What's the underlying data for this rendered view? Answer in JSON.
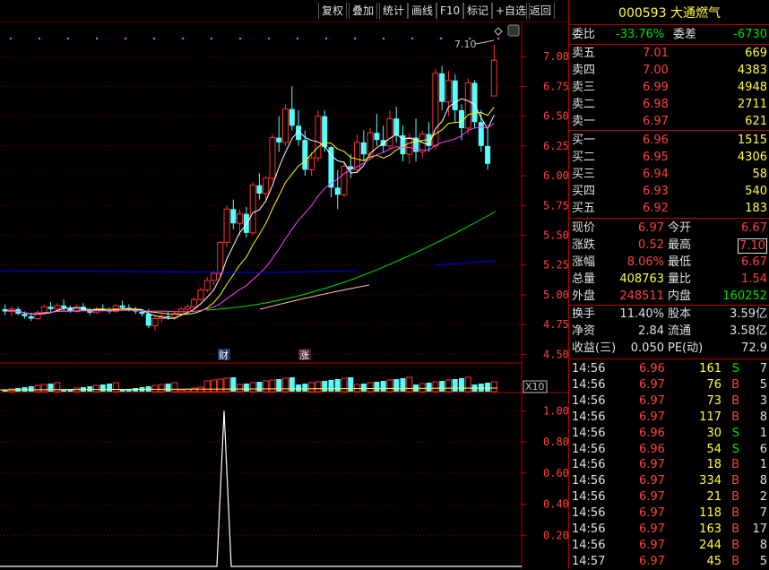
{
  "toolbar": {
    "buttons": [
      "复权",
      "叠加",
      "统计",
      "画线",
      "F10",
      "标记",
      "+自选",
      "返回"
    ]
  },
  "chart": {
    "price_ticks": [
      "7.00",
      "6.75",
      "6.50",
      "6.25",
      "6.00",
      "5.75",
      "5.50",
      "5.25",
      "5.00",
      "4.75",
      "4.50"
    ],
    "indicator_ticks": [
      "1.00",
      "0.80",
      "0.60",
      "0.40",
      "0.20"
    ],
    "high_label": "7.10",
    "event_labels": [
      "财",
      "涨"
    ],
    "volume_scale_label": "X10",
    "colors": {
      "up": "#ff3030",
      "down": "#54ffff",
      "ma5": "#ffffff",
      "ma10": "#ffff00",
      "ma20": "#ff40ff",
      "ma60": "#00e000",
      "ma120": "#ffc0c0",
      "ma250": "#0000ff"
    }
  },
  "chart_data": {
    "type": "candlestick",
    "y_range": [
      4.45,
      7.25
    ],
    "candles": [
      {
        "o": 4.88,
        "h": 4.92,
        "l": 4.83,
        "c": 4.86
      },
      {
        "o": 4.86,
        "h": 4.9,
        "l": 4.82,
        "c": 4.88
      },
      {
        "o": 4.88,
        "h": 4.9,
        "l": 4.83,
        "c": 4.84
      },
      {
        "o": 4.84,
        "h": 4.86,
        "l": 4.8,
        "c": 4.82
      },
      {
        "o": 4.82,
        "h": 4.85,
        "l": 4.78,
        "c": 4.8
      },
      {
        "o": 4.8,
        "h": 4.87,
        "l": 4.79,
        "c": 4.85
      },
      {
        "o": 4.85,
        "h": 4.92,
        "l": 4.84,
        "c": 4.9
      },
      {
        "o": 4.9,
        "h": 4.94,
        "l": 4.86,
        "c": 4.88
      },
      {
        "o": 4.88,
        "h": 4.93,
        "l": 4.86,
        "c": 4.91
      },
      {
        "o": 4.91,
        "h": 4.96,
        "l": 4.87,
        "c": 4.89
      },
      {
        "o": 4.89,
        "h": 4.91,
        "l": 4.85,
        "c": 4.86
      },
      {
        "o": 4.86,
        "h": 4.92,
        "l": 4.85,
        "c": 4.9
      },
      {
        "o": 4.9,
        "h": 4.93,
        "l": 4.86,
        "c": 4.87
      },
      {
        "o": 4.87,
        "h": 4.89,
        "l": 4.83,
        "c": 4.85
      },
      {
        "o": 4.85,
        "h": 4.9,
        "l": 4.84,
        "c": 4.88
      },
      {
        "o": 4.88,
        "h": 4.92,
        "l": 4.86,
        "c": 4.87
      },
      {
        "o": 4.87,
        "h": 4.89,
        "l": 4.84,
        "c": 4.86
      },
      {
        "o": 4.86,
        "h": 4.92,
        "l": 4.85,
        "c": 4.91
      },
      {
        "o": 4.91,
        "h": 4.95,
        "l": 4.88,
        "c": 4.89
      },
      {
        "o": 4.89,
        "h": 4.92,
        "l": 4.86,
        "c": 4.88
      },
      {
        "o": 4.88,
        "h": 4.9,
        "l": 4.84,
        "c": 4.86
      },
      {
        "o": 4.86,
        "h": 4.88,
        "l": 4.82,
        "c": 4.84
      },
      {
        "o": 4.84,
        "h": 4.88,
        "l": 4.72,
        "c": 4.74
      },
      {
        "o": 4.74,
        "h": 4.82,
        "l": 4.7,
        "c": 4.8
      },
      {
        "o": 4.8,
        "h": 4.84,
        "l": 4.77,
        "c": 4.82
      },
      {
        "o": 4.82,
        "h": 4.86,
        "l": 4.79,
        "c": 4.81
      },
      {
        "o": 4.81,
        "h": 4.86,
        "l": 4.79,
        "c": 4.84
      },
      {
        "o": 4.84,
        "h": 4.9,
        "l": 4.82,
        "c": 4.88
      },
      {
        "o": 4.88,
        "h": 4.92,
        "l": 4.86,
        "c": 4.9
      },
      {
        "o": 4.9,
        "h": 4.98,
        "l": 4.88,
        "c": 4.96
      },
      {
        "o": 4.96,
        "h": 5.06,
        "l": 4.95,
        "c": 5.04
      },
      {
        "o": 5.04,
        "h": 5.15,
        "l": 5.02,
        "c": 5.12
      },
      {
        "o": 5.12,
        "h": 5.2,
        "l": 5.08,
        "c": 5.18
      },
      {
        "o": 5.18,
        "h": 5.45,
        "l": 5.16,
        "c": 5.44
      },
      {
        "o": 5.44,
        "h": 5.75,
        "l": 5.4,
        "c": 5.72
      },
      {
        "o": 5.72,
        "h": 5.8,
        "l": 5.55,
        "c": 5.6
      },
      {
        "o": 5.6,
        "h": 5.72,
        "l": 5.5,
        "c": 5.68
      },
      {
        "o": 5.68,
        "h": 5.74,
        "l": 5.48,
        "c": 5.52
      },
      {
        "o": 5.52,
        "h": 5.95,
        "l": 5.5,
        "c": 5.92
      },
      {
        "o": 5.92,
        "h": 6.02,
        "l": 5.8,
        "c": 5.85
      },
      {
        "o": 5.85,
        "h": 6.0,
        "l": 5.78,
        "c": 5.98
      },
      {
        "o": 5.98,
        "h": 6.35,
        "l": 5.95,
        "c": 6.32
      },
      {
        "o": 6.32,
        "h": 6.5,
        "l": 6.2,
        "c": 6.28
      },
      {
        "o": 6.28,
        "h": 6.6,
        "l": 6.25,
        "c": 6.56
      },
      {
        "o": 6.56,
        "h": 6.75,
        "l": 6.38,
        "c": 6.42
      },
      {
        "o": 6.42,
        "h": 6.55,
        "l": 6.25,
        "c": 6.3
      },
      {
        "o": 6.3,
        "h": 6.38,
        "l": 6.0,
        "c": 6.05
      },
      {
        "o": 6.05,
        "h": 6.2,
        "l": 6.0,
        "c": 6.15
      },
      {
        "o": 6.15,
        "h": 6.55,
        "l": 6.12,
        "c": 6.5
      },
      {
        "o": 6.5,
        "h": 6.55,
        "l": 6.2,
        "c": 6.24
      },
      {
        "o": 6.24,
        "h": 6.25,
        "l": 5.82,
        "c": 5.9
      },
      {
        "o": 5.9,
        "h": 6.05,
        "l": 5.72,
        "c": 5.84
      },
      {
        "o": 5.84,
        "h": 6.12,
        "l": 5.82,
        "c": 6.08
      },
      {
        "o": 6.08,
        "h": 6.18,
        "l": 5.98,
        "c": 6.05
      },
      {
        "o": 6.05,
        "h": 6.35,
        "l": 6.02,
        "c": 6.28
      },
      {
        "o": 6.28,
        "h": 6.38,
        "l": 6.12,
        "c": 6.18
      },
      {
        "o": 6.18,
        "h": 6.4,
        "l": 6.15,
        "c": 6.36
      },
      {
        "o": 6.36,
        "h": 6.52,
        "l": 6.25,
        "c": 6.3
      },
      {
        "o": 6.3,
        "h": 6.42,
        "l": 6.2,
        "c": 6.25
      },
      {
        "o": 6.25,
        "h": 6.55,
        "l": 6.22,
        "c": 6.48
      },
      {
        "o": 6.48,
        "h": 6.58,
        "l": 6.28,
        "c": 6.34
      },
      {
        "o": 6.34,
        "h": 6.42,
        "l": 6.12,
        "c": 6.18
      },
      {
        "o": 6.18,
        "h": 6.36,
        "l": 6.1,
        "c": 6.32
      },
      {
        "o": 6.32,
        "h": 6.48,
        "l": 6.12,
        "c": 6.2
      },
      {
        "o": 6.2,
        "h": 6.38,
        "l": 6.15,
        "c": 6.35
      },
      {
        "o": 6.35,
        "h": 6.45,
        "l": 6.2,
        "c": 6.25
      },
      {
        "o": 6.25,
        "h": 6.9,
        "l": 6.22,
        "c": 6.86
      },
      {
        "o": 6.86,
        "h": 6.92,
        "l": 6.55,
        "c": 6.62
      },
      {
        "o": 6.62,
        "h": 6.88,
        "l": 6.5,
        "c": 6.8
      },
      {
        "o": 6.8,
        "h": 6.85,
        "l": 6.45,
        "c": 6.55
      },
      {
        "o": 6.55,
        "h": 6.6,
        "l": 6.3,
        "c": 6.4
      },
      {
        "o": 6.4,
        "h": 6.82,
        "l": 6.35,
        "c": 6.78
      },
      {
        "o": 6.78,
        "h": 6.8,
        "l": 6.4,
        "c": 6.45
      },
      {
        "o": 6.45,
        "h": 6.55,
        "l": 6.2,
        "c": 6.25
      },
      {
        "o": 6.25,
        "h": 6.4,
        "l": 6.05,
        "c": 6.1
      },
      {
        "o": 6.67,
        "h": 7.1,
        "l": 6.67,
        "c": 6.97
      }
    ],
    "indicator_peak": 1.0
  },
  "panel": {
    "code": "000593",
    "name": "大通燃气",
    "weibi_label": "委比",
    "weibi": "-33.76%",
    "weicha_label": "委差",
    "weicha": "-6730",
    "asks": [
      {
        "label": "卖五",
        "price": "7.01",
        "vol": "669"
      },
      {
        "label": "卖四",
        "price": "7.00",
        "vol": "4383"
      },
      {
        "label": "卖三",
        "price": "6.99",
        "vol": "4948"
      },
      {
        "label": "卖二",
        "price": "6.98",
        "vol": "2711"
      },
      {
        "label": "卖一",
        "price": "6.97",
        "vol": "621"
      }
    ],
    "bids": [
      {
        "label": "买一",
        "price": "6.96",
        "vol": "1515"
      },
      {
        "label": "买二",
        "price": "6.95",
        "vol": "4306"
      },
      {
        "label": "买三",
        "price": "6.94",
        "vol": "58"
      },
      {
        "label": "买四",
        "price": "6.93",
        "vol": "540"
      },
      {
        "label": "买五",
        "price": "6.92",
        "vol": "183"
      }
    ],
    "quote": [
      {
        "l1": "现价",
        "v1": "6.97",
        "l2": "今开",
        "v2": "6.67"
      },
      {
        "l1": "涨跌",
        "v1": "0.52",
        "l2": "最高",
        "v2": "7.10"
      },
      {
        "l1": "涨幅",
        "v1": "8.06%",
        "l2": "最低",
        "v2": "6.67"
      },
      {
        "l1": "总量",
        "v1": "408763",
        "l2": "量比",
        "v2": "1.54"
      },
      {
        "l1": "外盘",
        "v1": "248511",
        "l2": "内盘",
        "v2": "160252"
      }
    ],
    "fund": [
      {
        "l1": "换手",
        "v1": "11.40%",
        "l2": "股本",
        "v2": "3.59亿"
      },
      {
        "l1": "净资",
        "v1": "2.84",
        "l2": "流通",
        "v2": "3.58亿"
      },
      {
        "l1": "收益(三)",
        "v1": "0.050",
        "l2": "PE(动)",
        "v2": "72.9"
      }
    ],
    "ticks": [
      {
        "t": "14:56",
        "p": "6.96",
        "v": "161",
        "bs": "S",
        "n": "7"
      },
      {
        "t": "14:56",
        "p": "6.97",
        "v": "76",
        "bs": "B",
        "n": "5"
      },
      {
        "t": "14:56",
        "p": "6.97",
        "v": "73",
        "bs": "B",
        "n": "3"
      },
      {
        "t": "14:56",
        "p": "6.97",
        "v": "117",
        "bs": "B",
        "n": "8"
      },
      {
        "t": "14:56",
        "p": "6.96",
        "v": "30",
        "bs": "S",
        "n": "1"
      },
      {
        "t": "14:56",
        "p": "6.96",
        "v": "54",
        "bs": "S",
        "n": "6"
      },
      {
        "t": "14:56",
        "p": "6.97",
        "v": "18",
        "bs": "B",
        "n": "1"
      },
      {
        "t": "14:56",
        "p": "6.97",
        "v": "334",
        "bs": "B",
        "n": "8"
      },
      {
        "t": "14:56",
        "p": "6.97",
        "v": "21",
        "bs": "B",
        "n": "2"
      },
      {
        "t": "14:56",
        "p": "6.97",
        "v": "118",
        "bs": "B",
        "n": "7"
      },
      {
        "t": "14:56",
        "p": "6.97",
        "v": "163",
        "bs": "B",
        "n": "17"
      },
      {
        "t": "14:56",
        "p": "6.97",
        "v": "244",
        "bs": "B",
        "n": "8"
      },
      {
        "t": "14:57",
        "p": "6.97",
        "v": "45",
        "bs": "B",
        "n": "5"
      }
    ]
  }
}
